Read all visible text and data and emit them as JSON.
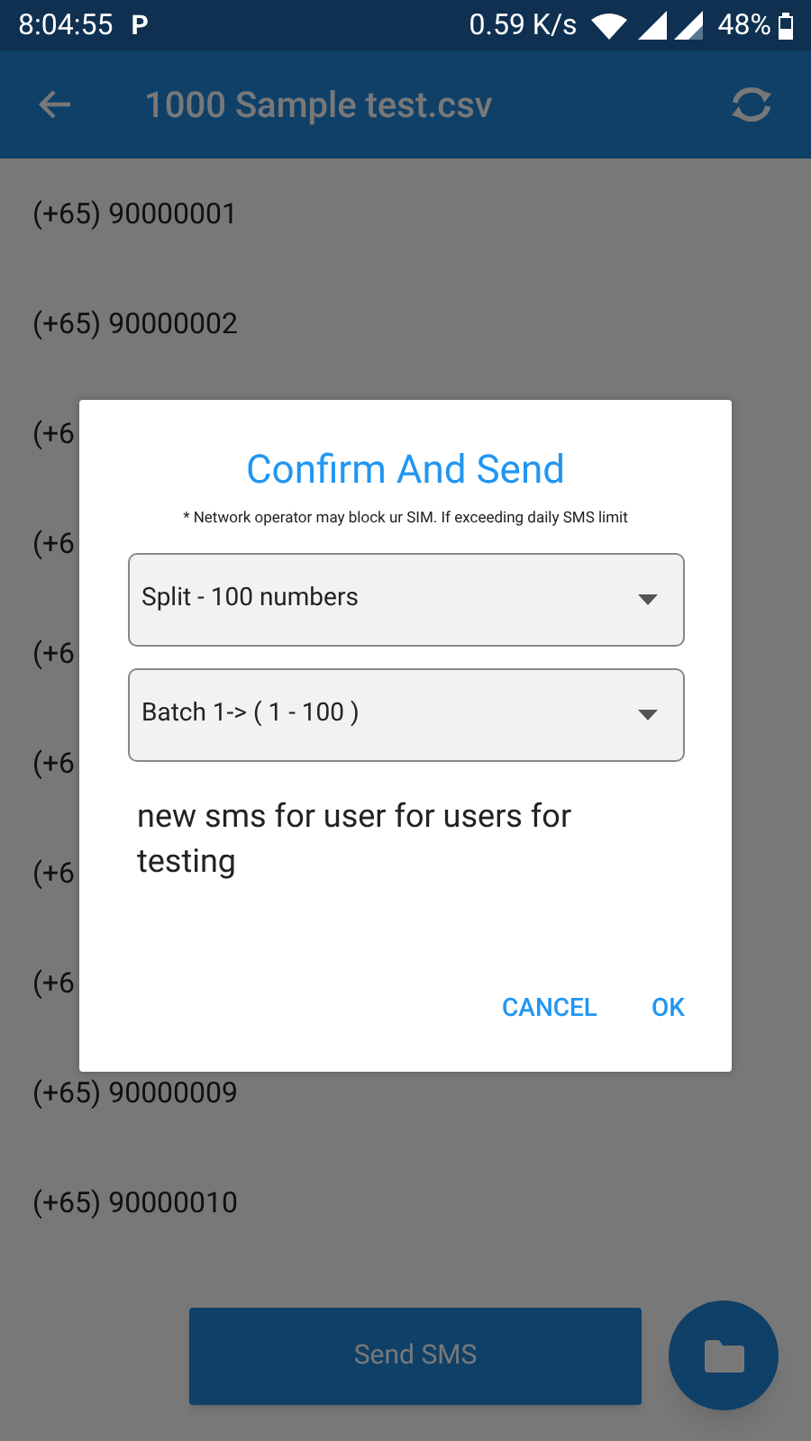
{
  "status_bar": {
    "time": "8:04:55",
    "app_badge": "P",
    "speed": "0.59 K/s",
    "battery": "48%"
  },
  "app_bar": {
    "title": "1000 Sample test.csv"
  },
  "contacts": [
    {
      "number": "(+65) 90000001"
    },
    {
      "number": "(+65) 90000002"
    },
    {
      "number": "(+6"
    },
    {
      "number": "(+6"
    },
    {
      "number": "(+6"
    },
    {
      "number": "(+6"
    },
    {
      "number": "(+6"
    },
    {
      "number": "(+6"
    },
    {
      "number": "(+65) 90000009"
    },
    {
      "number": "(+65) 90000010"
    }
  ],
  "send_button": {
    "label": "Send SMS"
  },
  "dialog": {
    "title": "Confirm And Send",
    "note": "* Network operator may block ur SIM. If exceeding daily SMS limit",
    "dropdowns": [
      {
        "value": "Split - 100 numbers"
      },
      {
        "value": "Batch 1-> ( 1 - 100 )"
      }
    ],
    "message": "new sms for user for users for testing",
    "buttons": [
      "CANCEL",
      "OK"
    ]
  }
}
